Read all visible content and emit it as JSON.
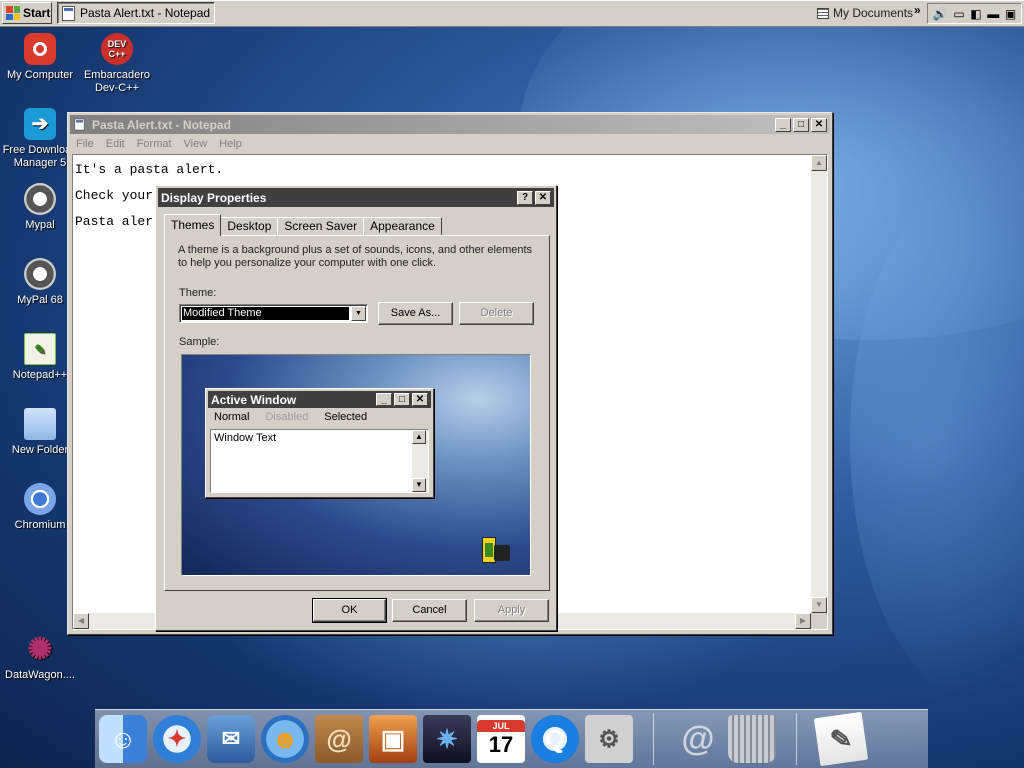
{
  "taskbar": {
    "start_label": "Start",
    "task_label": "Pasta Alert.txt - Notepad",
    "toolbar_label": "My Documents",
    "chevron": "»"
  },
  "desktop_icons": [
    {
      "label": "My Computer",
      "icon": "camera-icon",
      "color": "#d83a2e"
    },
    {
      "label": "Embarcadero Dev-C++",
      "icon": "devcpp-icon",
      "color": "#c9302c",
      "badge": "DEV C++"
    },
    {
      "label": "Free Download Manager 5",
      "icon": "download-manager-icon",
      "color": "#1c9ad6"
    },
    {
      "label": "Mypal",
      "icon": "raccoon-icon"
    },
    {
      "label": "MyPal 68",
      "icon": "raccoon-icon"
    },
    {
      "label": "Notepad++",
      "icon": "notepadpp-icon",
      "color": "#7ec447"
    },
    {
      "label": "New Folder",
      "icon": "folder-icon",
      "color": "#8fb9e8"
    },
    {
      "label": "Chromium",
      "icon": "chromium-icon",
      "color": "#3c7ad6"
    },
    {
      "label": "DataWagon....",
      "icon": "datawagon-icon",
      "color": "#b0306a"
    }
  ],
  "notepad": {
    "title": "Pasta Alert.txt - Notepad",
    "menu": [
      "File",
      "Edit",
      "Format",
      "View",
      "Help"
    ],
    "lines": [
      "It's a pasta alert.",
      "Check your",
      "Pasta aler"
    ]
  },
  "dialog": {
    "title": "Display Properties",
    "tabs": [
      "Themes",
      "Desktop",
      "Screen Saver",
      "Appearance"
    ],
    "active_tab": "Themes",
    "description": "A theme is a background plus a set of sounds, icons, and other elements to help you personalize your computer with one click.",
    "theme_label": "Theme:",
    "theme_value": "Modified Theme",
    "save_as_label": "Save As...",
    "delete_label": "Delete",
    "sample_label": "Sample:",
    "ok_label": "OK",
    "cancel_label": "Cancel",
    "apply_label": "Apply",
    "preview": {
      "title": "Active Window",
      "menu": [
        "Normal",
        "Disabled",
        "Selected"
      ],
      "text": "Window Text"
    }
  },
  "dock": {
    "items": [
      "finder-icon",
      "safari-icon",
      "mail-icon",
      "ichat-icon",
      "address-book-icon",
      "iphoto-icon",
      "imovie-icon",
      "ical-icon",
      "quicktime-icon",
      "system-preferences-icon",
      "at-sign-icon",
      "trash-icon",
      "textedit-icon"
    ],
    "calendar_month": "JUL",
    "calendar_day": "17"
  }
}
